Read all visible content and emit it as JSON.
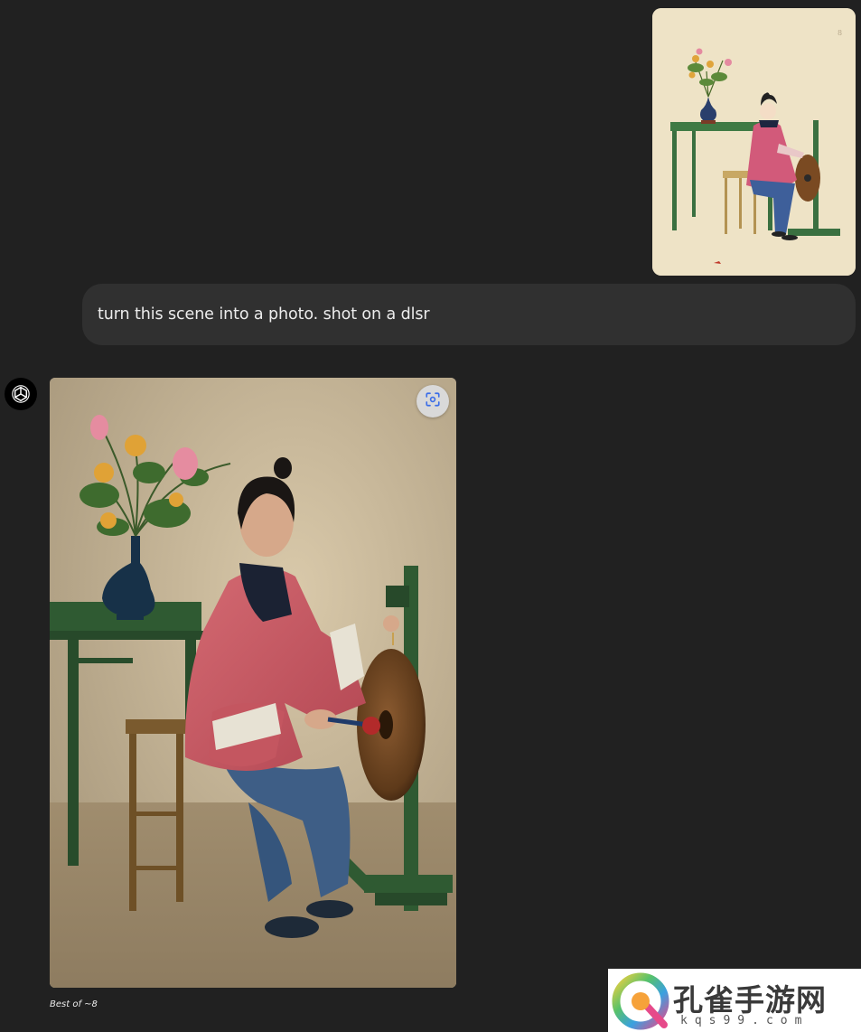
{
  "conversation": {
    "user_message": {
      "attachment_icon": "painting-attachment",
      "text": "turn this scene into a photo. shot on a dlsr"
    },
    "assistant_message": {
      "avatar_icon": "openai-logo-icon",
      "image_icon": "generated-photo",
      "select_button_icon": "select-region-icon",
      "caption": "Best of ~8"
    }
  },
  "watermark": {
    "title": "孔雀手游网",
    "subtitle": "kqs99.com"
  },
  "colors": {
    "background": "#212121",
    "user_bubble": "#303030",
    "text": "#ececec"
  }
}
